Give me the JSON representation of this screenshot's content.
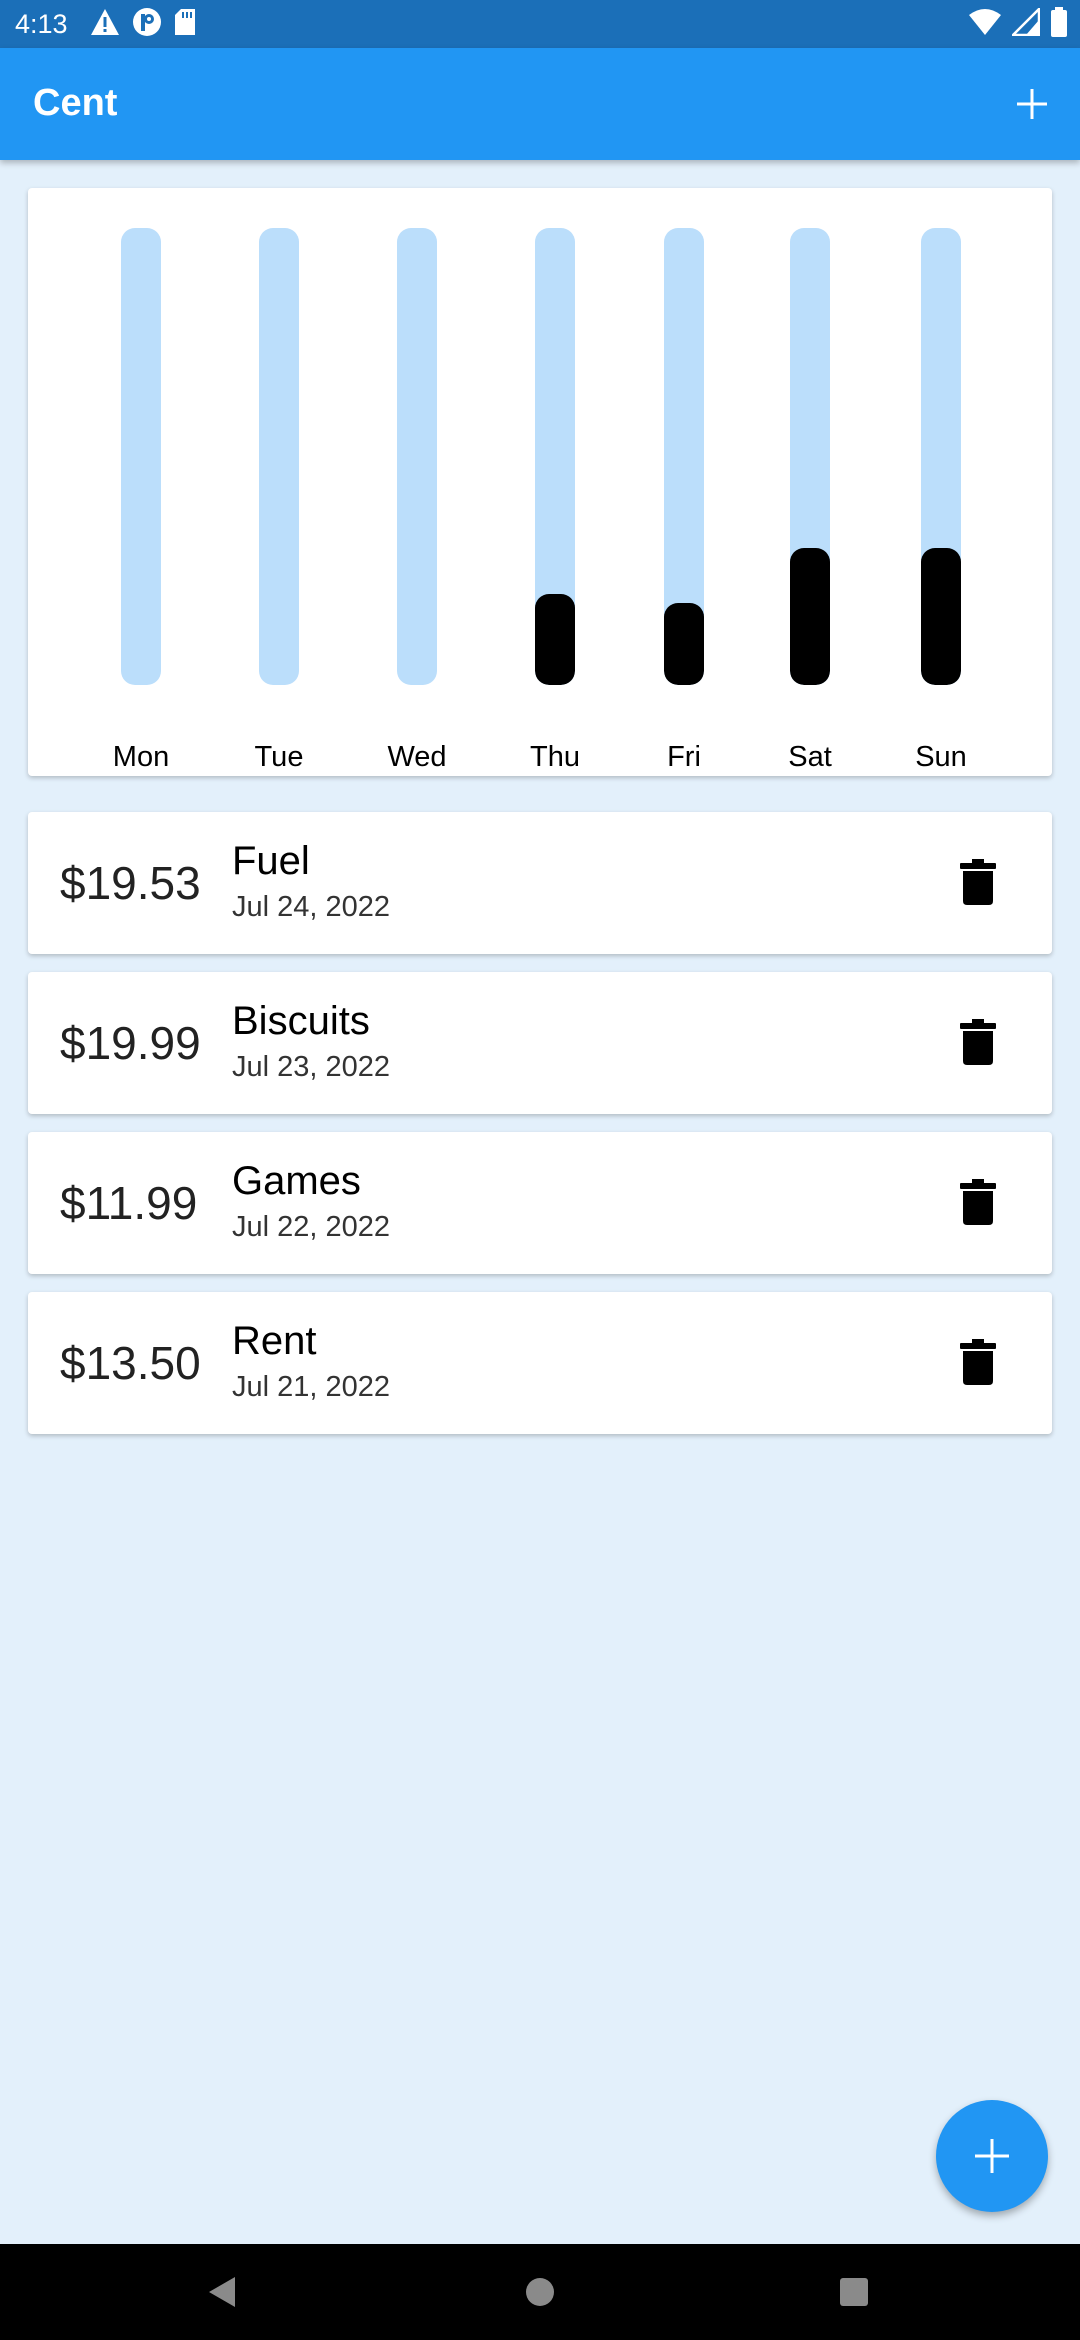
{
  "status_bar": {
    "time": "4:13",
    "left_icons": [
      "warning-icon",
      "p-icon",
      "sd-card-icon"
    ],
    "right_icons": [
      "wifi-icon",
      "signal-icon",
      "battery-icon"
    ]
  },
  "app_bar": {
    "title": "Cent",
    "action_icon": "add-icon"
  },
  "chart_data": {
    "type": "bar",
    "categories": [
      "Mon",
      "Tue",
      "Wed",
      "Thu",
      "Fri",
      "Sat",
      "Sun"
    ],
    "values": [
      0,
      0,
      0,
      0.2,
      0.18,
      0.3,
      0.3
    ],
    "value_unit": "fraction of weekly spending",
    "ylim": [
      0,
      1
    ],
    "track_color": "#bbdefb",
    "fill_color": "#000000"
  },
  "transactions": [
    {
      "amount": "$19.53",
      "title": "Fuel",
      "date": "Jul 24, 2022"
    },
    {
      "amount": "$19.99",
      "title": "Biscuits",
      "date": "Jul 23, 2022"
    },
    {
      "amount": "$11.99",
      "title": "Games",
      "date": "Jul 22, 2022"
    },
    {
      "amount": "$13.50",
      "title": "Rent",
      "date": "Jul 21, 2022"
    }
  ],
  "fab": {
    "icon": "add-icon"
  },
  "nav_bar": {
    "icons": [
      "back-icon",
      "home-icon",
      "recents-icon"
    ]
  },
  "colors": {
    "primary": "#2196f3",
    "status_bar": "#1b6fb8",
    "background": "#e3f0fb",
    "card": "#ffffff"
  }
}
